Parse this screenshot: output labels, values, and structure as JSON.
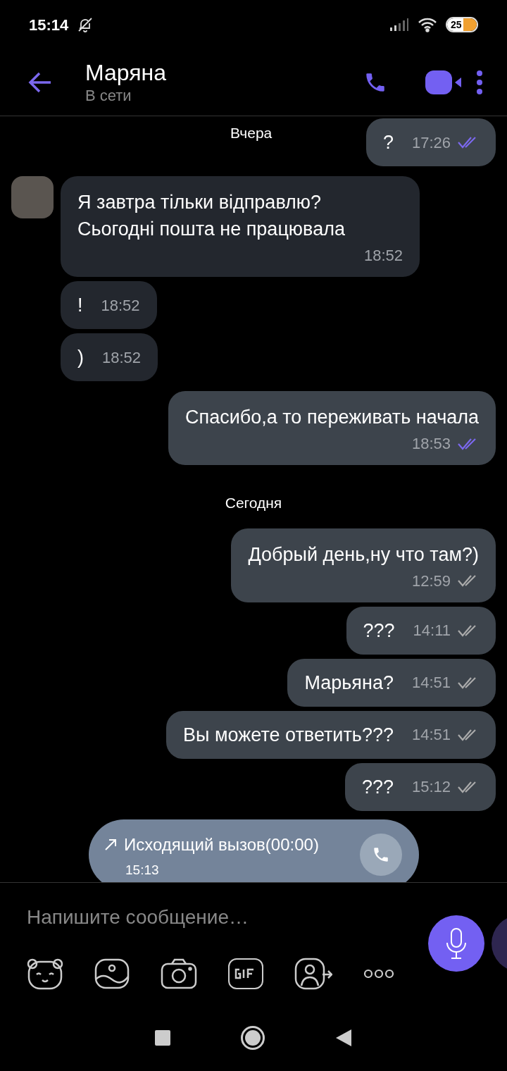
{
  "status_bar": {
    "time": "15:14",
    "battery": "25"
  },
  "header": {
    "name": "Маряна",
    "status": "В сети"
  },
  "floating_date": "Вчера",
  "messages": [
    {
      "kind": "out",
      "text": "?",
      "time": "17:26",
      "seen": true,
      "time_below": false
    },
    {
      "kind": "in",
      "text": "Я завтра тільки відправлю? Сьогодні пошта не працювала",
      "time": "18:52",
      "time_below": true
    },
    {
      "kind": "in",
      "text": "!",
      "time": "18:52",
      "time_below": false
    },
    {
      "kind": "in",
      "text": ")",
      "time": "18:52",
      "time_below": false
    },
    {
      "kind": "out",
      "text": "Спасибо,а то переживать начала",
      "time": "18:53",
      "seen": true,
      "time_below": true
    },
    {
      "kind": "date",
      "text": "Сегодня"
    },
    {
      "kind": "out",
      "text": "Добрый день,ну что там?)",
      "time": "12:59",
      "seen": false,
      "time_below": true
    },
    {
      "kind": "out",
      "text": "???",
      "time": "14:11",
      "seen": false,
      "time_below": false
    },
    {
      "kind": "out",
      "text": "Марьяна?",
      "time": "14:51",
      "seen": false,
      "time_below": false
    },
    {
      "kind": "out",
      "text": "Вы можете ответить???",
      "time": "14:51",
      "seen": false,
      "time_below": false
    },
    {
      "kind": "out",
      "text": "???",
      "time": "15:12",
      "seen": false,
      "time_below": false
    },
    {
      "kind": "call",
      "text": "Исходящий вызов(00:00)",
      "time": "15:13"
    }
  ],
  "composer": {
    "placeholder": "Напишите сообщение…"
  }
}
